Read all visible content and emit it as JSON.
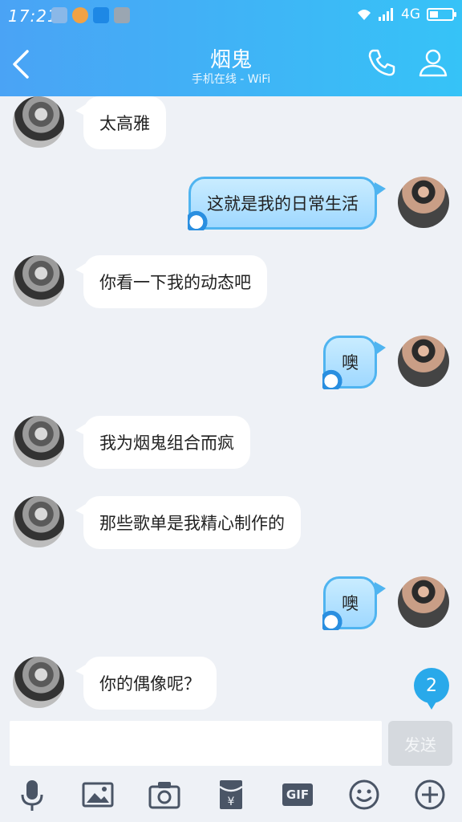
{
  "status_bar": {
    "time": "17:21",
    "network": "4G"
  },
  "header": {
    "title": "烟鬼",
    "subtitle": "手机在线 - WiFi"
  },
  "messages": [
    {
      "side": "left",
      "text": "太高雅"
    },
    {
      "side": "right",
      "text": "这就是我的日常生活"
    },
    {
      "side": "left",
      "text": "你看一下我的动态吧"
    },
    {
      "side": "right",
      "text": "噢"
    },
    {
      "side": "left",
      "text": "我为烟鬼组合而疯"
    },
    {
      "side": "left",
      "text": "那些歌单是我精心制作的"
    },
    {
      "side": "right",
      "text": "噢"
    },
    {
      "side": "left",
      "text": "你的偶像呢？"
    }
  ],
  "unread_count": "2",
  "composer": {
    "value": "",
    "placeholder": "",
    "send_label": "发送"
  },
  "toolbar": {
    "gif_label": "GIF"
  },
  "colors": {
    "header_start": "#4aa3f5",
    "header_end": "#36c3f7",
    "badge": "#29a9ea",
    "bubble_right_border": "#4fb4f0"
  }
}
